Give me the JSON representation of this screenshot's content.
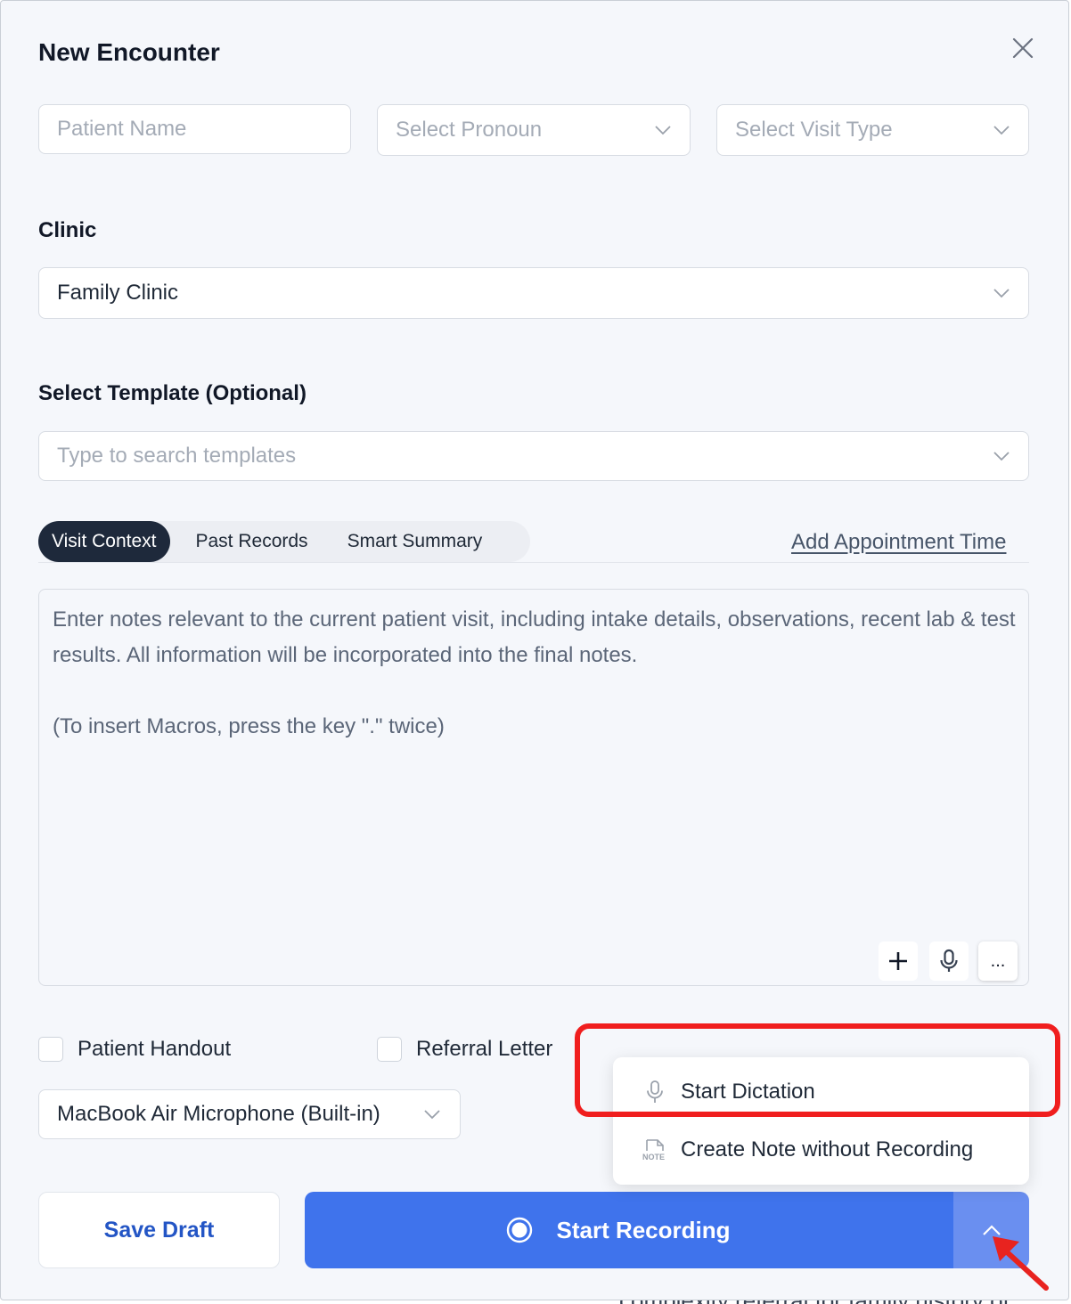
{
  "modal": {
    "title": "New Encounter"
  },
  "patient": {
    "name_placeholder": "Patient Name",
    "pronoun_placeholder": "Select Pronoun",
    "visit_type_placeholder": "Select Visit Type"
  },
  "clinic": {
    "label": "Clinic",
    "value": "Family Clinic"
  },
  "template": {
    "label": "Select Template (Optional)",
    "placeholder": "Type to search templates"
  },
  "tabs": [
    {
      "label": "Visit Context",
      "active": true
    },
    {
      "label": "Past Records",
      "active": false
    },
    {
      "label": "Smart Summary",
      "active": false
    }
  ],
  "appointment_link": "Add Appointment Time",
  "notes": {
    "placeholder_line1": "Enter notes relevant to the current patient visit, including intake details, observations, recent lab & test results. All information will be incorporated into the final notes.",
    "placeholder_line2": "(To insert Macros, press the key \".\" twice)",
    "tools": [
      {
        "icon": "plus-icon"
      },
      {
        "icon": "microphone-icon"
      },
      {
        "icon": "more-icon",
        "label": "..."
      }
    ]
  },
  "options": {
    "patient_handout": "Patient Handout",
    "referral_letter": "Referral Letter"
  },
  "microphone": {
    "value": "MacBook Air Microphone (Built-in)"
  },
  "dropdown_menu": {
    "items": [
      {
        "label": "Start Dictation",
        "icon": "microphone-icon"
      },
      {
        "label": "Create Note without Recording",
        "icon": "note-icon",
        "icon_text": "NOTE"
      }
    ]
  },
  "actions": {
    "save_draft": "Save Draft",
    "start_recording": "Start Recording"
  },
  "background_text": "complexity referral for family history of",
  "colors": {
    "primary": "#3f73ec",
    "primary_light": "#6a8ff0",
    "active_tab": "#1e293b",
    "save_text": "#2355c5",
    "annotation": "#f01e1e"
  }
}
